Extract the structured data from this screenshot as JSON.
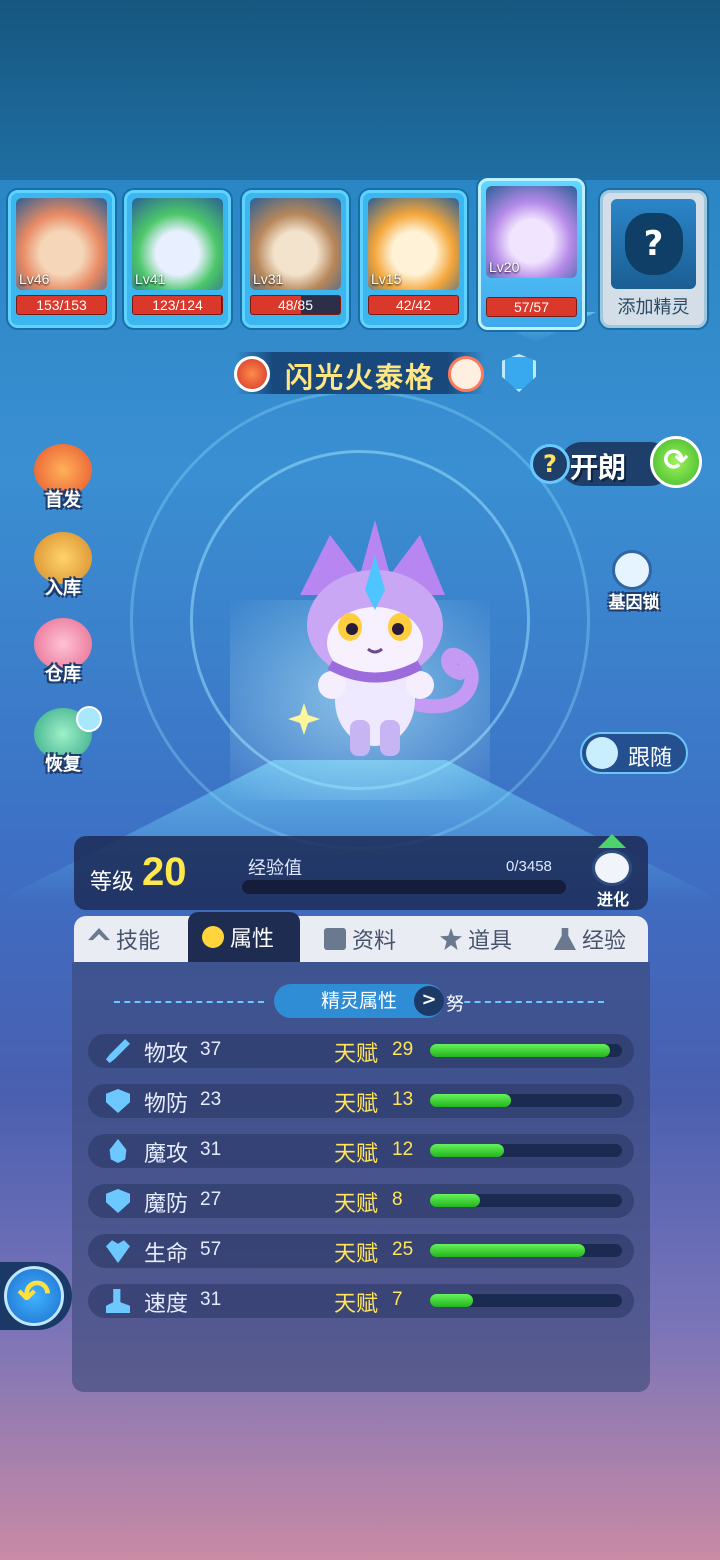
{
  "team": [
    {
      "level": "Lv46",
      "hp": "153/153",
      "hp_fraction": 1.0,
      "palette": [
        "#e88a63",
        "#f5d6b8"
      ]
    },
    {
      "level": "Lv41",
      "hp": "123/124",
      "hp_fraction": 0.99,
      "palette": [
        "#4cc76a",
        "#e8f0ff"
      ]
    },
    {
      "level": "Lv31",
      "hp": "48/85",
      "hp_fraction": 0.56,
      "palette": [
        "#b7875a",
        "#f3e3cc"
      ]
    },
    {
      "level": "Lv15",
      "hp": "42/42",
      "hp_fraction": 1.0,
      "palette": [
        "#f4a63a",
        "#fff2d6"
      ]
    },
    {
      "level": "Lv20",
      "hp": "57/57",
      "hp_fraction": 1.0,
      "palette": [
        "#b58ae8",
        "#f1e4ff"
      ],
      "active": true
    }
  ],
  "add_slot": {
    "icon": "?",
    "label": "添加精灵"
  },
  "pet": {
    "name": "闪光火泰格",
    "element_icon": "fire-icon"
  },
  "side_menu": {
    "first_label": "首发",
    "store_label": "入库",
    "warehouse_label": "仓库",
    "recover_label": "恢复"
  },
  "open_button": {
    "q": "?",
    "label": "开朗",
    "refresh": "⟳"
  },
  "gene_lock_label": "基因锁",
  "follow_label": "跟随",
  "level": {
    "label": "等级",
    "value": "20",
    "exp_label": "经验值",
    "exp_value": "0/3458",
    "exp_fraction": 0,
    "evolve_label": "进化"
  },
  "tabs": [
    "技能",
    "属性",
    "资料",
    "道具",
    "经验"
  ],
  "active_tab_index": 1,
  "attributes": {
    "header": "精灵属性",
    "chevron": ">",
    "nature": "努",
    "talent_label": "天赋",
    "talent_max": 31,
    "rows": [
      {
        "name": "物攻",
        "value": "37",
        "talent": "29",
        "icon": "sword-icon"
      },
      {
        "name": "物防",
        "value": "23",
        "talent": "13",
        "icon": "shield-icon"
      },
      {
        "name": "魔攻",
        "value": "31",
        "talent": "12",
        "icon": "flame-icon"
      },
      {
        "name": "魔防",
        "value": "27",
        "talent": "8",
        "icon": "magic-shield-icon"
      },
      {
        "name": "生命",
        "value": "57",
        "talent": "25",
        "icon": "heart-icon"
      },
      {
        "name": "速度",
        "value": "31",
        "talent": "7",
        "icon": "boot-icon"
      }
    ]
  },
  "back_icon": "↶",
  "colors": {
    "accent_yellow": "#ffe94a",
    "talent_bar": "#24b51e",
    "hp_bar": "#d9382a"
  }
}
